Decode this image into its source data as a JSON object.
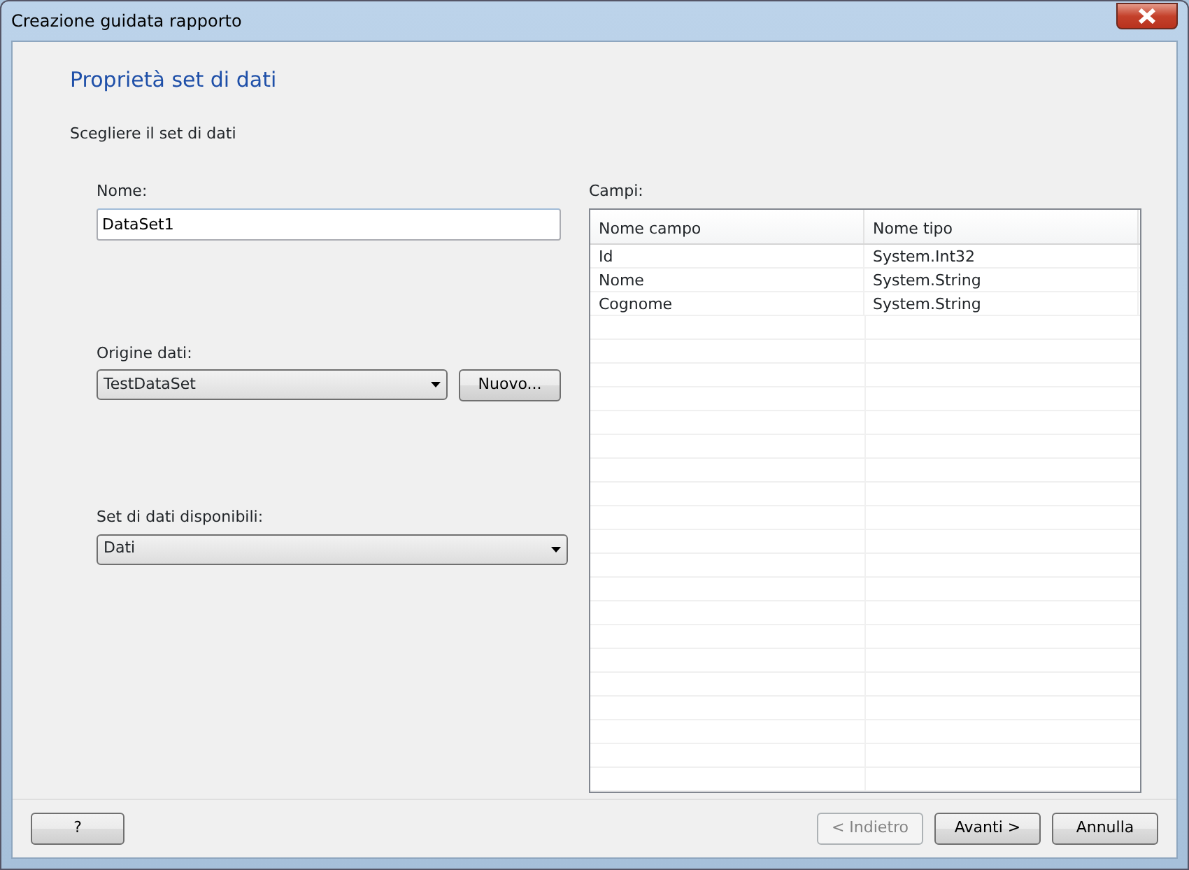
{
  "window": {
    "title": "Creazione guidata rapporto"
  },
  "heading": "Proprietà set di dati",
  "instruction": "Scegliere il set di dati",
  "name_field": {
    "label": "Nome:",
    "value": "DataSet1"
  },
  "source_field": {
    "label": "Origine dati:",
    "value": "TestDataSet"
  },
  "new_button": {
    "label": "Nuovo..."
  },
  "datasets_field": {
    "label": "Set di dati disponibili:",
    "value": "Dati"
  },
  "fields_table": {
    "label": "Campi:",
    "columns": [
      "Nome campo",
      "Nome tipo"
    ],
    "rows": [
      [
        "Id",
        "System.Int32"
      ],
      [
        "Nome",
        "System.String"
      ],
      [
        "Cognome",
        "System.String"
      ]
    ]
  },
  "footer": {
    "help": "?",
    "buttons": [
      {
        "label": "< Indietro",
        "disabled": true
      },
      {
        "label": "Avanti >",
        "disabled": false
      },
      {
        "label": "Annulla",
        "disabled": false
      }
    ]
  }
}
